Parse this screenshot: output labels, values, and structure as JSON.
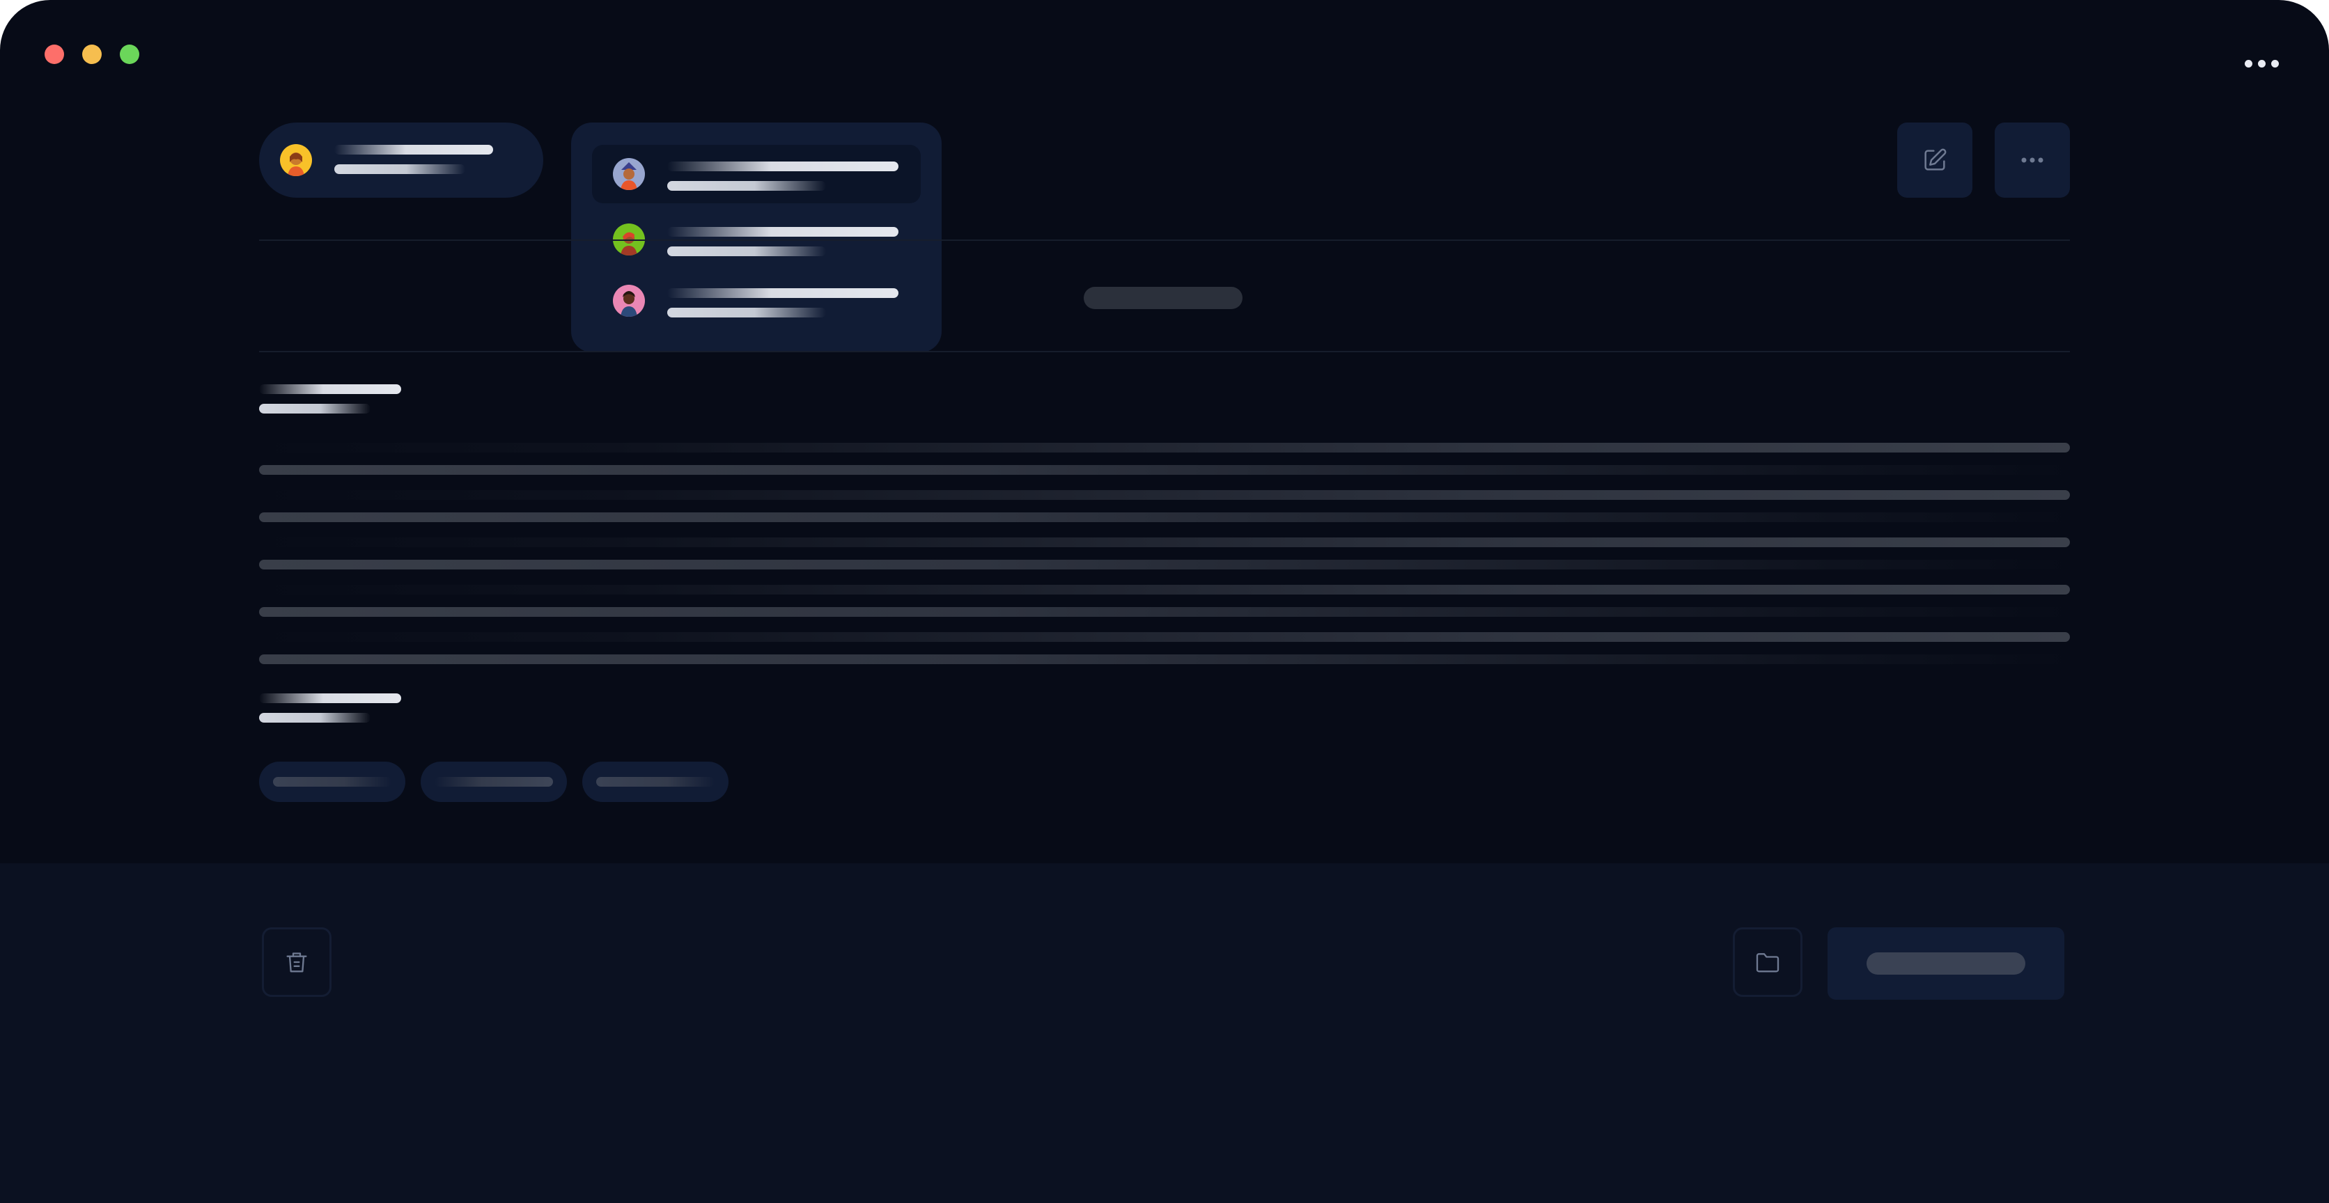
{
  "window": {
    "controls": [
      {
        "name": "close",
        "color": "#fd6f6a"
      },
      {
        "name": "minimize",
        "color": "#f6be4f"
      },
      {
        "name": "maximize",
        "color": "#6bd65a"
      }
    ],
    "menu_icon": "more-horizontal-icon"
  },
  "header": {
    "account": {
      "avatar": "person-avatar",
      "avatar_color": "#f8c129"
    },
    "account_dropdown": {
      "items": [
        {
          "avatar": "person-avatar",
          "avatar_color": "#98a6cf",
          "active": true
        },
        {
          "avatar": "person-avatar",
          "avatar_color": "#74c11f",
          "active": false
        },
        {
          "avatar": "person-avatar",
          "avatar_color": "#ea87b4",
          "active": false
        }
      ]
    },
    "actions": [
      {
        "icon": "edit-icon"
      },
      {
        "icon": "more-horizontal-icon"
      }
    ]
  },
  "footer": {
    "left_action": {
      "icon": "trash-icon"
    },
    "right_actions": [
      {
        "icon": "folder-icon"
      }
    ]
  },
  "colors": {
    "background": "#070b17",
    "surface": "#111c35",
    "footer": "#0b1121",
    "divider": "#161d2c"
  }
}
